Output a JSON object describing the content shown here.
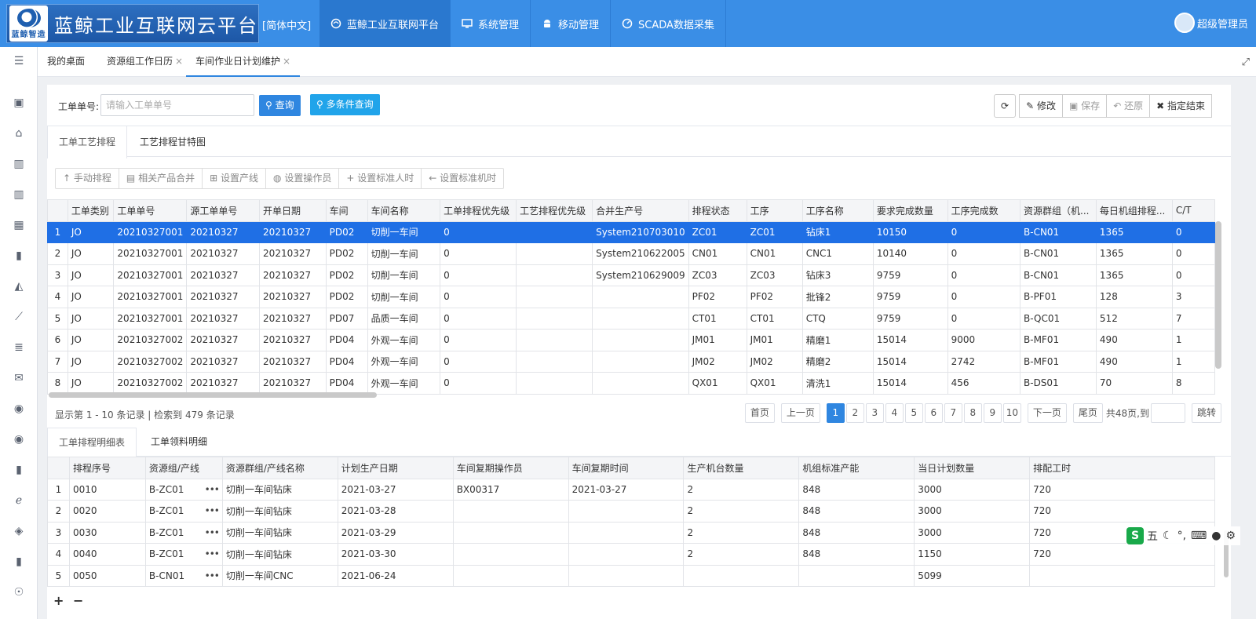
{
  "header": {
    "logo_label": "蓝鲸智造",
    "title": "蓝鲸工业互联网云平台",
    "language": "[简体中文]",
    "nav": [
      {
        "label": "蓝鲸工业互联网平台",
        "icon": "platform-icon"
      },
      {
        "label": "系统管理",
        "icon": "monitor-icon"
      },
      {
        "label": "移动管理",
        "icon": "android-icon"
      },
      {
        "label": "SCADA数据采集",
        "icon": "gauge-icon"
      }
    ],
    "user": "超级管理员"
  },
  "page_tabs": [
    {
      "label": "我的桌面"
    },
    {
      "label": "资源组工作日历",
      "close": "×"
    },
    {
      "label": "车间作业日计划维护",
      "close": "×"
    }
  ],
  "search": {
    "label": "工单单号:",
    "placeholder": "请输入工单单号",
    "query_btn": "查询",
    "multi_query_btn": "多条件查询"
  },
  "toolbar": {
    "refresh_icon": "refresh-icon",
    "edit": "修改",
    "save": "保存",
    "restore": "还原",
    "force_end": "指定结束"
  },
  "upper_tabs": [
    "工单工艺排程",
    "工艺排程甘特图"
  ],
  "action_buttons": [
    "手动排程",
    "相关产品合并",
    "设置产线",
    "设置操作员",
    "设置标准人时",
    "设置标准机时"
  ],
  "upper_grid": {
    "columns": [
      "",
      "工单类别",
      "工单单号",
      "源工单单号",
      "开单日期",
      "车间",
      "车间名称",
      "工单排程优先级",
      "工艺排程优先级",
      "合并生产号",
      "排程状态",
      "工序",
      "工序名称",
      "要求完成数量",
      "工序完成数",
      "资源群组（机...",
      "每日机组排程...",
      "C/T"
    ],
    "rows": [
      [
        "1",
        "JO",
        "20210327001",
        "20210327",
        "20210327",
        "PD02",
        "切削一车间",
        "0",
        "",
        "System210703010",
        "ZC01",
        "ZC01",
        "钻床1",
        "10150",
        "0",
        "B-CN01",
        "1365",
        "0"
      ],
      [
        "2",
        "JO",
        "20210327001",
        "20210327",
        "20210327",
        "PD02",
        "切削一车间",
        "0",
        "",
        "System210622005",
        "CN01",
        "CN01",
        "CNC1",
        "10140",
        "0",
        "B-CN01",
        "1365",
        "0"
      ],
      [
        "3",
        "JO",
        "20210327001",
        "20210327",
        "20210327",
        "PD02",
        "切削一车间",
        "0",
        "",
        "System210629009",
        "ZC03",
        "ZC03",
        "钻床3",
        "9759",
        "0",
        "B-CN01",
        "1365",
        "0"
      ],
      [
        "4",
        "JO",
        "20210327001",
        "20210327",
        "20210327",
        "PD02",
        "切削一车间",
        "0",
        "",
        "",
        "PF02",
        "PF02",
        "批锋2",
        "9759",
        "0",
        "B-PF01",
        "128",
        "3"
      ],
      [
        "5",
        "JO",
        "20210327001",
        "20210327",
        "20210327",
        "PD07",
        "品质一车间",
        "0",
        "",
        "",
        "CT01",
        "CT01",
        "CTQ",
        "9759",
        "0",
        "B-QC01",
        "512",
        "7"
      ],
      [
        "6",
        "JO",
        "20210327002",
        "20210327",
        "20210327",
        "PD04",
        "外观一车间",
        "0",
        "",
        "",
        "JM01",
        "JM01",
        "精磨1",
        "15014",
        "9000",
        "B-MF01",
        "490",
        "1"
      ],
      [
        "7",
        "JO",
        "20210327002",
        "20210327",
        "20210327",
        "PD04",
        "外观一车间",
        "0",
        "",
        "",
        "JM02",
        "JM02",
        "精磨2",
        "15014",
        "2742",
        "B-MF01",
        "490",
        "1"
      ],
      [
        "8",
        "JO",
        "20210327002",
        "20210327",
        "20210327",
        "PD04",
        "外观一车间",
        "0",
        "",
        "",
        "QX01",
        "QX01",
        "清洗1",
        "15014",
        "456",
        "B-DS01",
        "70",
        "8"
      ]
    ],
    "selected_row": 0
  },
  "pagination": {
    "info": "显示第 1 - 10 条记录 | 检索到 479 条记录",
    "first": "首页",
    "prev": "上一页",
    "pages": [
      "1",
      "2",
      "3",
      "4",
      "5",
      "6",
      "7",
      "8",
      "9",
      "10"
    ],
    "current": "1",
    "next": "下一页",
    "last": "尾页",
    "total": "共48页,到",
    "jump": "跳转"
  },
  "lower_tabs": [
    "工单排程明细表",
    "工单领料明细"
  ],
  "lower_grid": {
    "columns": [
      "",
      "排程序号",
      "资源组/产线",
      "资源群组/产线名称",
      "计划生产日期",
      "车间复期操作员",
      "车间复期时间",
      "生产机台数量",
      "机组标准产能",
      "当日计划数量",
      "排配工时"
    ],
    "rows": [
      [
        "1",
        "0010",
        "B-ZC01",
        "切削一车间钻床",
        "2021-03-27",
        "BX00317",
        "2021-03-27",
        "2",
        "848",
        "3000",
        "720"
      ],
      [
        "2",
        "0020",
        "B-ZC01",
        "切削一车间钻床",
        "2021-03-28",
        "",
        "",
        "2",
        "848",
        "3000",
        "720"
      ],
      [
        "3",
        "0030",
        "B-ZC01",
        "切削一车间钻床",
        "2021-03-29",
        "",
        "",
        "2",
        "848",
        "3000",
        "720"
      ],
      [
        "4",
        "0040",
        "B-ZC01",
        "切削一车间钻床",
        "2021-03-30",
        "",
        "",
        "2",
        "848",
        "1150",
        "720"
      ],
      [
        "5",
        "0050",
        "B-CN01",
        "切削一车间CNC",
        "2021-06-24",
        "",
        "",
        "",
        "",
        "5099",
        ""
      ]
    ],
    "dots": "•••",
    "add": "+",
    "remove": "−"
  },
  "ime": {
    "brand": "S",
    "mode": "五",
    "icons": [
      "☾",
      "°,",
      "⌨",
      "●",
      "⚙"
    ]
  }
}
